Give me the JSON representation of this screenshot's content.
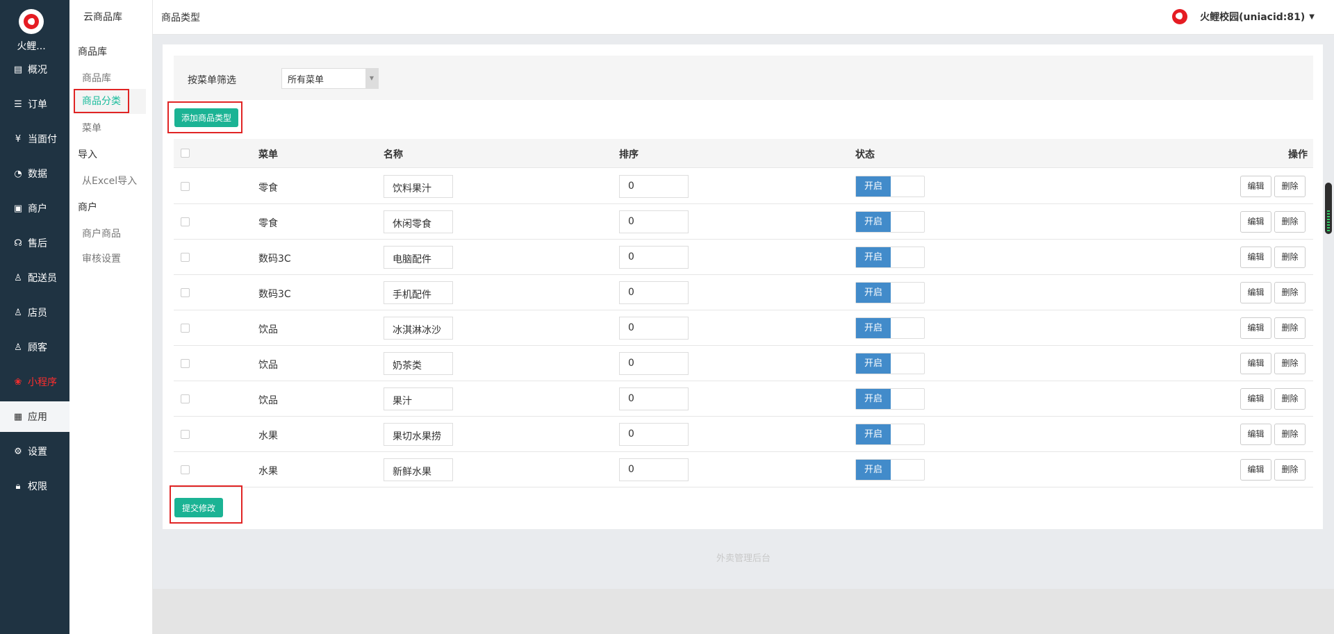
{
  "app": {
    "brand": "火鲤..."
  },
  "main_nav": [
    {
      "label": "概况",
      "icon": "overview-icon"
    },
    {
      "label": "订单",
      "icon": "order-icon"
    },
    {
      "label": "当面付",
      "icon": "yuan-icon"
    },
    {
      "label": "数据",
      "icon": "chart-icon"
    },
    {
      "label": "商户",
      "icon": "store-icon"
    },
    {
      "label": "售后",
      "icon": "headset-icon"
    },
    {
      "label": "配送员",
      "icon": "user-icon"
    },
    {
      "label": "店员",
      "icon": "staff-icon"
    },
    {
      "label": "顾客",
      "icon": "customer-icon"
    },
    {
      "label": "小程序",
      "icon": "miniprogram-icon"
    },
    {
      "label": "应用",
      "icon": "apps-icon"
    },
    {
      "label": "设置",
      "icon": "gear-icon"
    },
    {
      "label": "权限",
      "icon": "lock-icon"
    }
  ],
  "sub_nav": {
    "title": "云商品库",
    "groups": [
      {
        "label": "商品库",
        "items": [
          "商品库",
          "商品分类",
          "菜单"
        ]
      },
      {
        "label": "导入",
        "items": [
          "从Excel导入"
        ]
      },
      {
        "label": "商户",
        "items": [
          "商户商品",
          "审核设置"
        ]
      }
    ],
    "active": "商品分类"
  },
  "header": {
    "page_title": "商品类型",
    "user": "火鲤校园(uniacid:81)"
  },
  "filter": {
    "label": "按菜单筛选",
    "selected": "所有菜单"
  },
  "buttons": {
    "add": "添加商品类型",
    "submit": "提交修改"
  },
  "table": {
    "columns": [
      "菜单",
      "名称",
      "排序",
      "状态",
      "操作"
    ],
    "rows": [
      {
        "menu": "零食",
        "name": "饮料果汁",
        "sort": "0",
        "status": "开启"
      },
      {
        "menu": "零食",
        "name": "休闲零食",
        "sort": "0",
        "status": "开启"
      },
      {
        "menu": "数码3C",
        "name": "电脑配件",
        "sort": "0",
        "status": "开启"
      },
      {
        "menu": "数码3C",
        "name": "手机配件",
        "sort": "0",
        "status": "开启"
      },
      {
        "menu": "饮品",
        "name": "冰淇淋冰沙",
        "sort": "0",
        "status": "开启"
      },
      {
        "menu": "饮品",
        "name": "奶茶类",
        "sort": "0",
        "status": "开启"
      },
      {
        "menu": "饮品",
        "name": "果汁",
        "sort": "0",
        "status": "开启"
      },
      {
        "menu": "水果",
        "name": "果切水果捞",
        "sort": "0",
        "status": "开启"
      },
      {
        "menu": "水果",
        "name": "新鲜水果",
        "sort": "0",
        "status": "开启"
      }
    ],
    "edit_label": "编辑",
    "delete_label": "删除"
  },
  "footer": "外卖管理后台"
}
